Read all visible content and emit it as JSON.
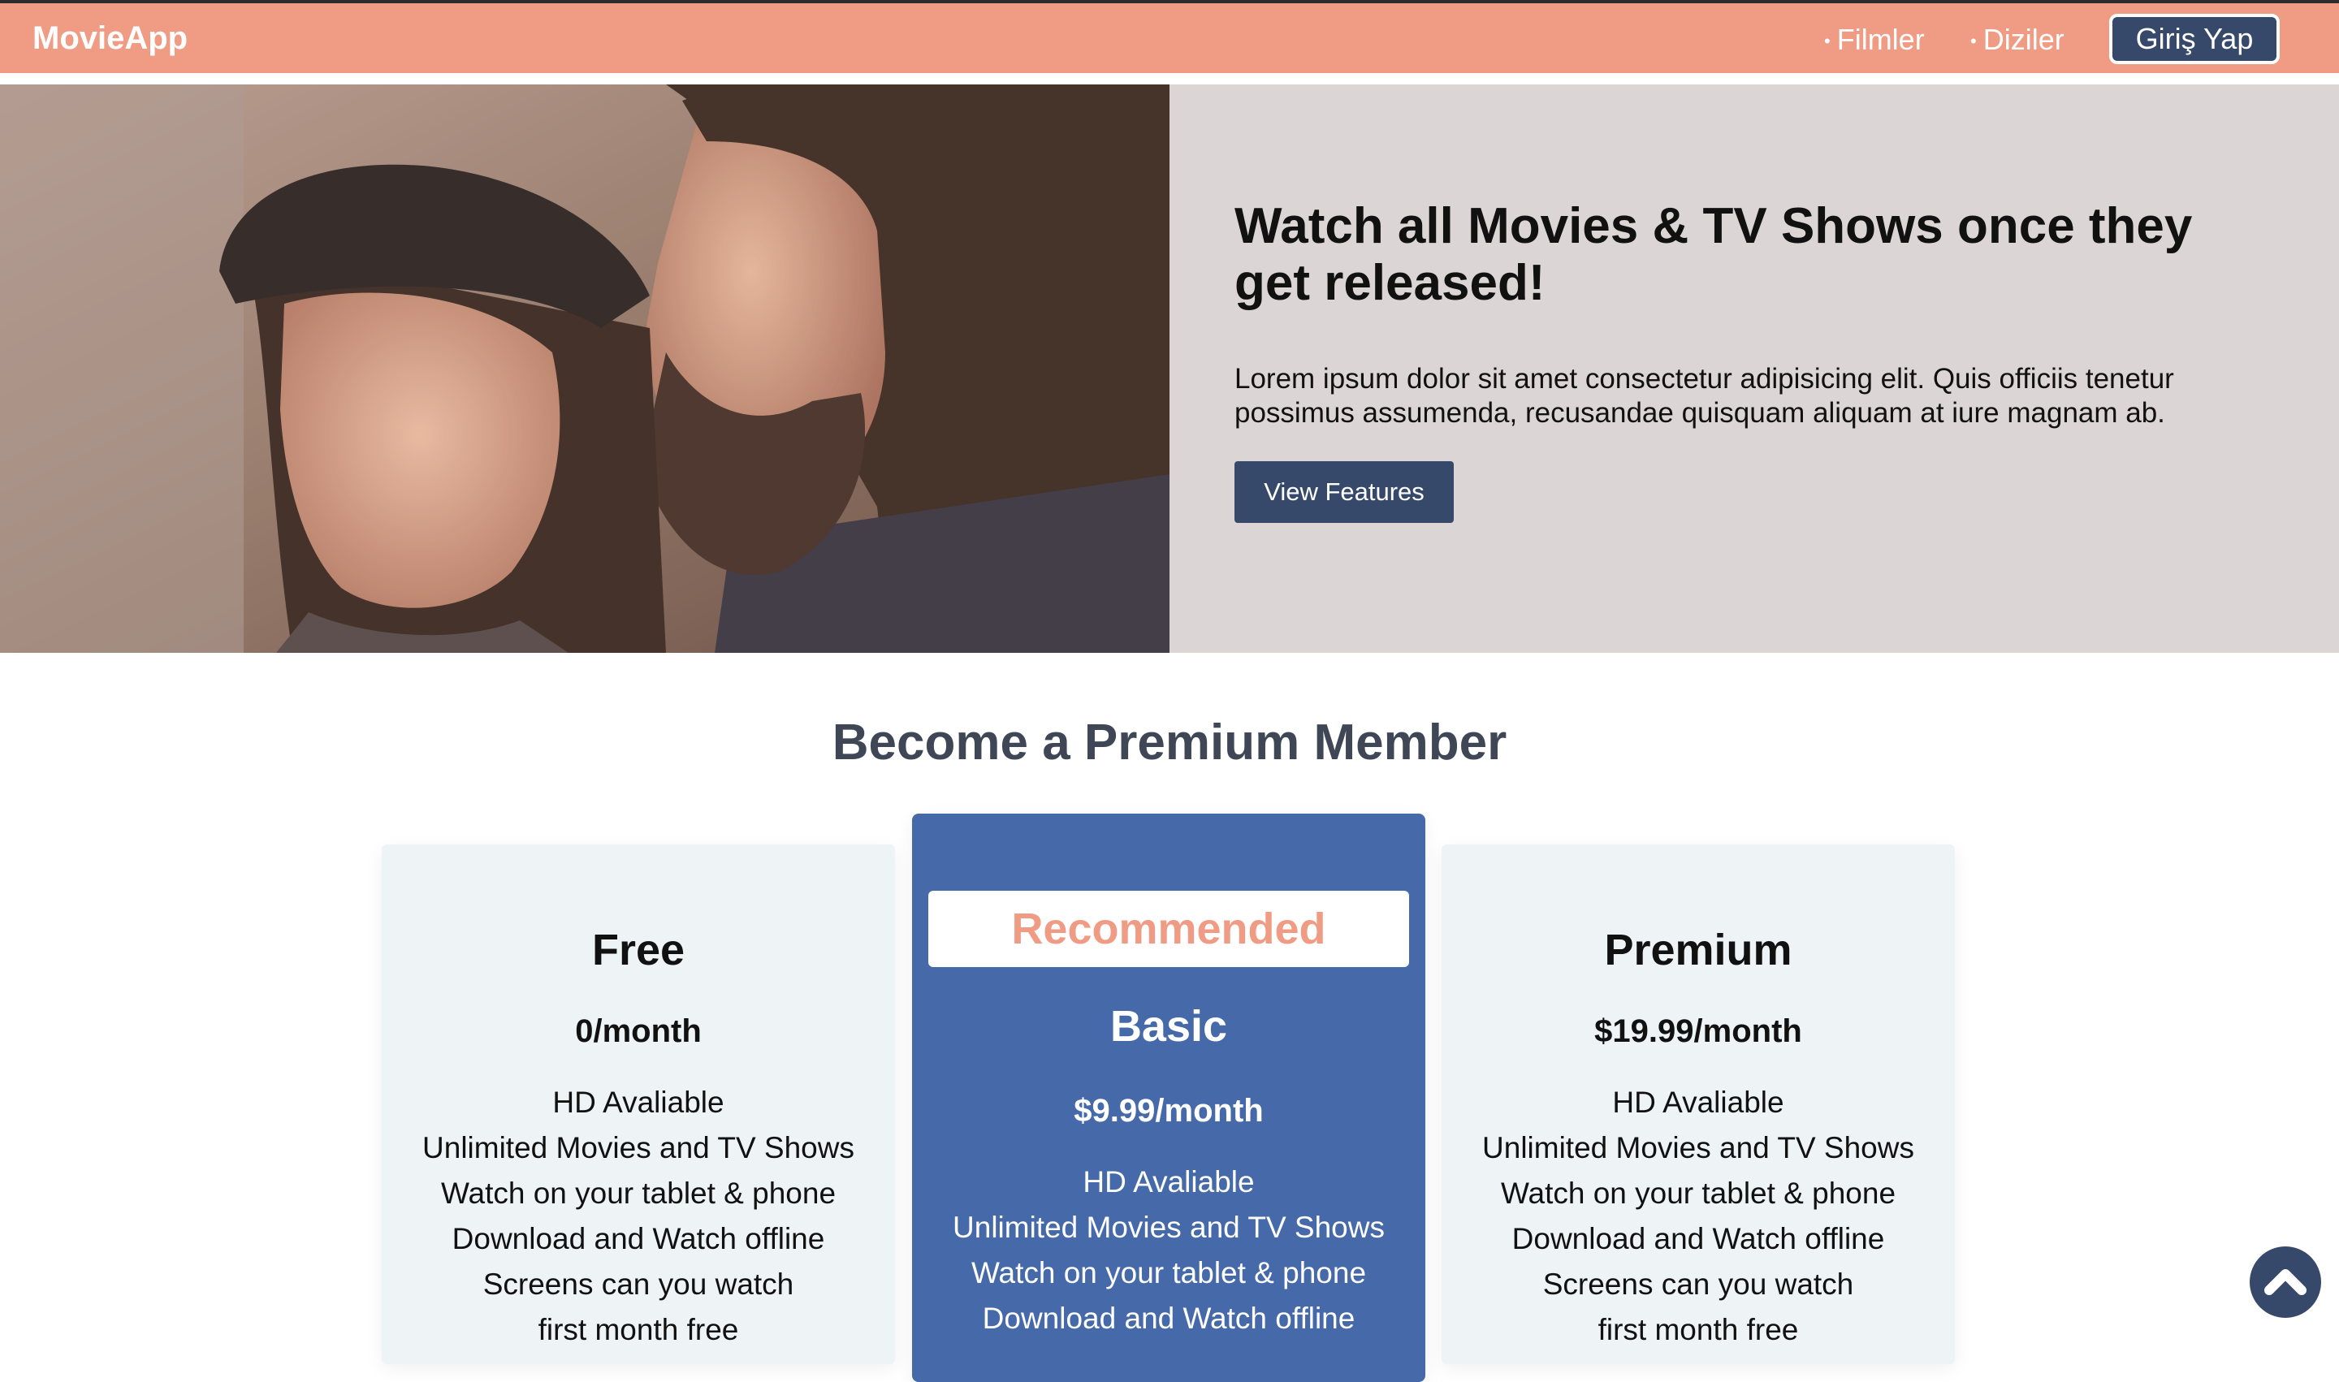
{
  "navbar": {
    "brand": "MovieApp",
    "links": [
      {
        "label": "Filmler"
      },
      {
        "label": "Diziler"
      }
    ],
    "login_label": "Giriş Yap",
    "background": "#f09c84"
  },
  "hero": {
    "title": "Watch all Movies & TV Shows once they get released!",
    "text": "Lorem ipsum dolor sit amet consectetur adipisicing elit. Quis officiis tenetur possimus assumenda, recusandae quisquam aliquam at iure magnam ab.",
    "button_label": "View Features",
    "panel_color": "#dcd5d5"
  },
  "pricing": {
    "title": "Become a Premium Member",
    "plans": [
      {
        "name": "Free",
        "price": "0/month",
        "features": [
          "HD Avaliable",
          "Unlimited Movies and TV Shows",
          "Watch on your tablet & phone",
          "Download and Watch offline",
          "Screens can you watch",
          "first month free"
        ]
      },
      {
        "badge": "Recommended",
        "name": "Basic",
        "price": "$9.99/month",
        "features": [
          "HD Avaliable",
          "Unlimited Movies and TV Shows",
          "Watch on your tablet & phone",
          "Download and Watch offline"
        ]
      },
      {
        "name": "Premium",
        "price": "$19.99/month",
        "features": [
          "HD Avaliable",
          "Unlimited Movies and TV Shows",
          "Watch on your tablet & phone",
          "Download and Watch offline",
          "Screens can you watch",
          "first month free"
        ]
      }
    ],
    "accent": "#4569a9"
  },
  "icons": {
    "scroll_top": "chevron-up-icon"
  }
}
